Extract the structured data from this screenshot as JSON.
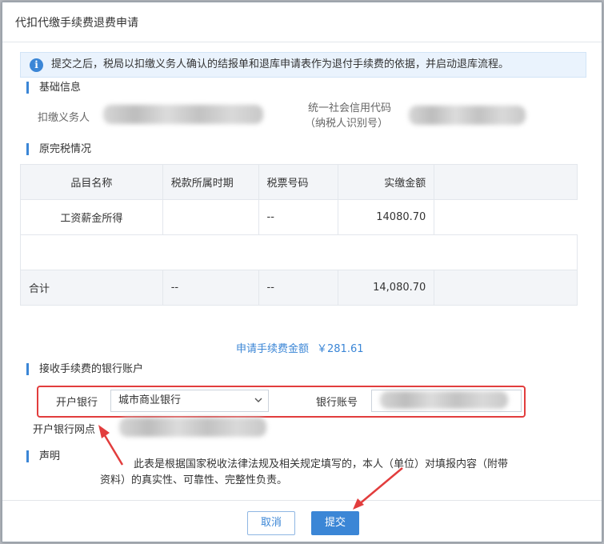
{
  "dialog": {
    "title": "代扣代缴手续费退费申请"
  },
  "notice": {
    "icon": "info-icon",
    "text": "提交之后，税局以扣缴义务人确认的结报单和退库申请表作为退付手续费的依据，并启动退库流程。"
  },
  "basic_info": {
    "heading": "基础信息",
    "withholder_label": "扣缴义务人",
    "credit_code_label_line1": "统一社会信用代码",
    "credit_code_label_line2": "（纳税人识别号）"
  },
  "tax_paid": {
    "heading": "原完税情况",
    "columns": [
      "品目名称",
      "税款所属时期",
      "税票号码",
      "实缴金额"
    ],
    "rows": [
      {
        "item": "工资薪金所得",
        "period": "",
        "ticket": "--",
        "amount": "14080.70"
      }
    ],
    "total": {
      "label": "合计",
      "period": "--",
      "ticket": "--",
      "amount": "14,080.70"
    }
  },
  "apply_amount": {
    "label": "申请手续费金额",
    "value": "￥281.61"
  },
  "bank": {
    "heading": "接收手续费的银行账户",
    "bank_label": "开户银行",
    "bank_value": "城市商业银行",
    "account_label": "银行账号",
    "branch_label": "开户银行网点"
  },
  "declaration": {
    "heading": "声明",
    "text": "此表是根据国家税收法律法规及相关规定填写的，本人（单位）对填报内容（附带资料）的真实性、可靠性、完整性负责。"
  },
  "footer": {
    "cancel_label": "取消",
    "submit_label": "提交"
  },
  "colors": {
    "accent": "#3b86d6",
    "annotation": "#e23d3d",
    "notice_bg": "#eaf3fd"
  }
}
